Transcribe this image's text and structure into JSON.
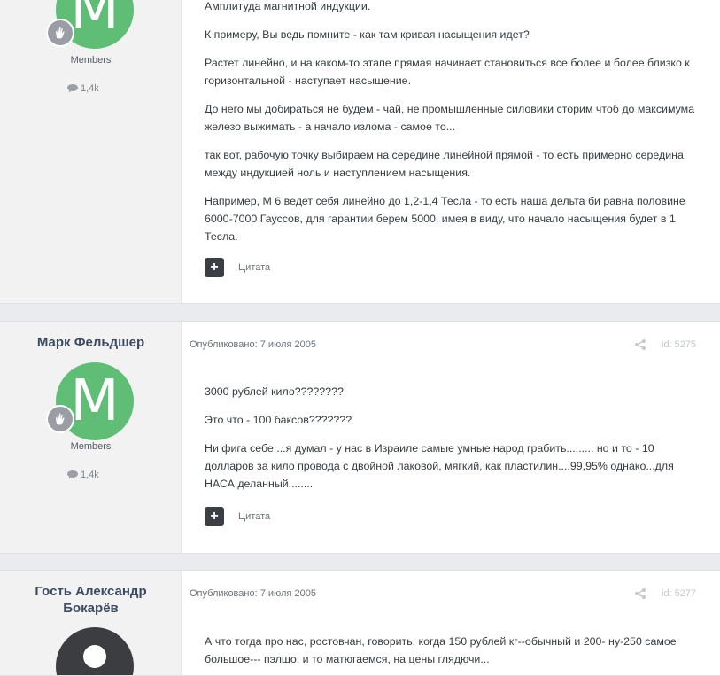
{
  "posts": [
    {
      "author": "",
      "avatar_letter": "M",
      "group": "Members",
      "post_count": "1,4k",
      "paragraphs": [
        "Амплитуда магнитной индукции.",
        "К примеру, Вы ведь помните - как там кривая насыщения идет?",
        "Растет линейно, и на каком-то этапе прямая начинает становиться все более и более близко к горизонтальной - наступает насыщение.",
        "До него мы добираться не будем - чай, не промышленные силовики сторим чтоб до максимума железо выжимать - а начало излома - самое то...",
        "так вот, рабочую точку выбираем на середине линейной прямой - то есть примерно середина между индукцией ноль и наступлением насыщения.",
        "Например, М 6 ведет себя линейно до 1,2-1,4 Тесла - то есть наша дельта би равна половине 6000-7000 Гауссов, для гарантии берем 5000, имея в виду, что начало насыщения будет в 1 Тесла."
      ],
      "quote_label": "Цитата"
    },
    {
      "author": "Марк Фельдшер",
      "avatar_letter": "M",
      "group": "Members",
      "post_count": "1,4k",
      "published": "Опубликовано: 7 июля 2005",
      "id_label": "id: 5275",
      "paragraphs": [
        "3000 рублей кило????????",
        "Это что - 100 баксов???????",
        "Ни фига себе....я думал - у нас в Израиле самые умные народ грабить......... но и то - 10 долларов за кило провода с двойной лаковой, мягкий, как пластилин....99,95% однако...для НАСА деланный........"
      ],
      "quote_label": "Цитата"
    },
    {
      "author_line1": "Гость Александр",
      "author_line2": "Бокарёв",
      "published": "Опубликовано: 7 июля 2005",
      "id_label": "id: 5277",
      "paragraphs": [
        "А что тогда про нас, ростовчан, говорить, когда 150 рублей кг--обычный и 200- ну-250 самое большое--- пэлшо, и то матюгаемся, на цены глядючи..."
      ]
    }
  ],
  "icons": {
    "badge": "raised-hand-icon",
    "posts": "speech-bubble-icon",
    "share": "share-icon",
    "multiquote": "plus-icon"
  },
  "colors": {
    "avatar_green": "#5fbd76",
    "author_name": "#3d4a5f",
    "page_bg": "#e9ebef"
  }
}
